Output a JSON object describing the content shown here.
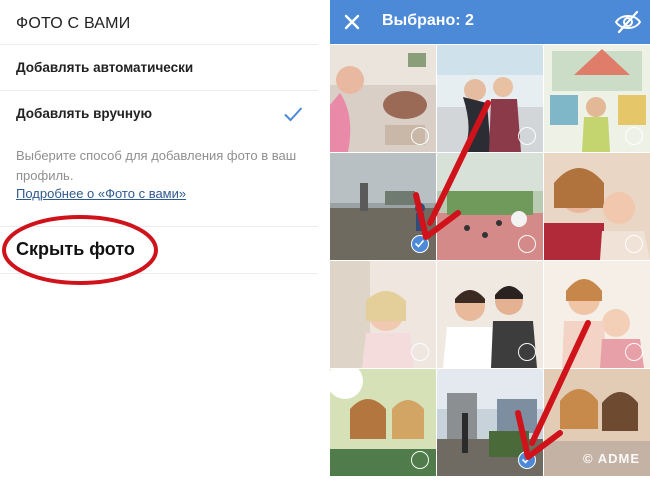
{
  "settings": {
    "section_title": "ФОТО С ВАМИ",
    "auto_add": "Добавлять автоматически",
    "manual_add": "Добавлять вручную",
    "description": "Выберите способ для добавления фото в ваш профиль.",
    "more_link": "Подробнее о «Фото с вами»",
    "hide_photo": "Скрыть фото",
    "accent_color": "#4c8ad8",
    "highlight_color": "#d0121b"
  },
  "picker": {
    "title": "Выбрано: 2",
    "close_icon": "close-icon",
    "hide_icon": "eye-off-icon",
    "header_color": "#4c8ad8",
    "photos": [
      {
        "selected": false
      },
      {
        "selected": false
      },
      {
        "selected": false
      },
      {
        "selected": true
      },
      {
        "selected": false
      },
      {
        "selected": false
      },
      {
        "selected": false
      },
      {
        "selected": false
      },
      {
        "selected": false
      },
      {
        "selected": false
      },
      {
        "selected": true
      },
      {
        "selected": false
      }
    ],
    "watermark": "© ADME"
  }
}
